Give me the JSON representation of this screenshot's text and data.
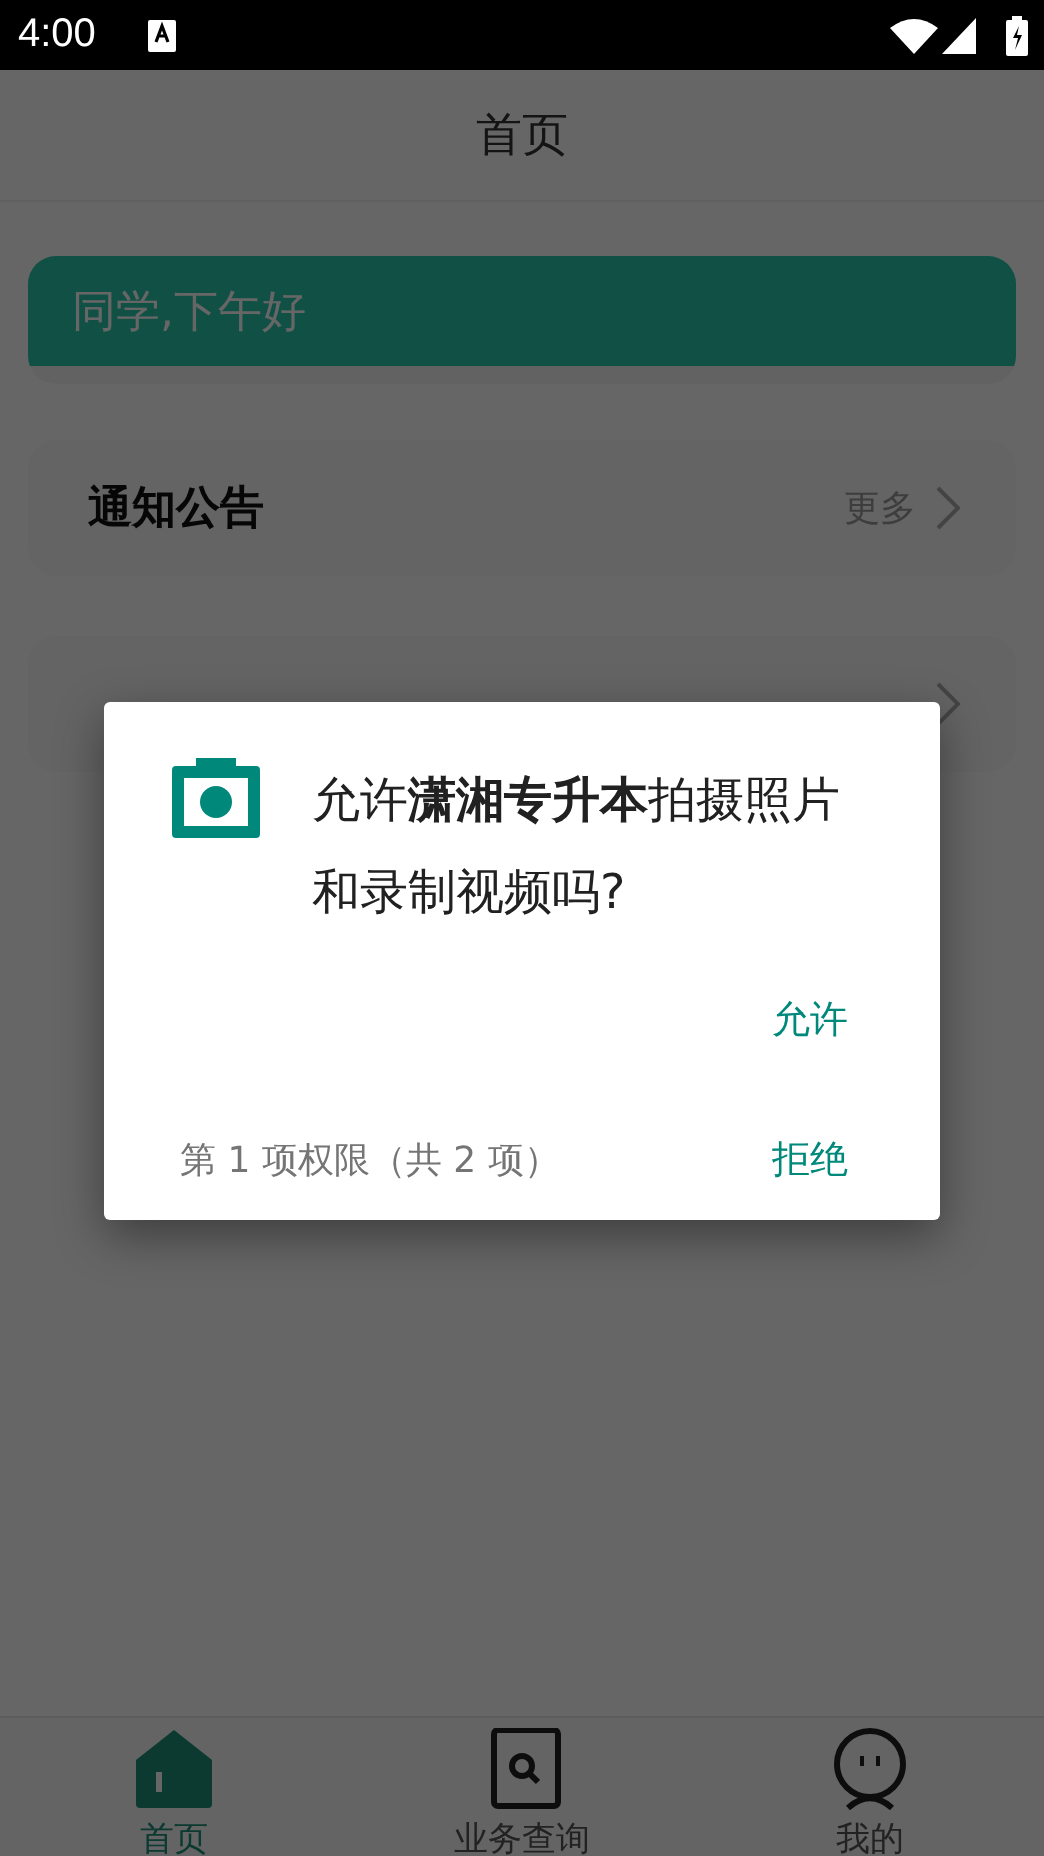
{
  "status_bar": {
    "time": "4:00"
  },
  "header": {
    "title": "首页"
  },
  "greeting": {
    "text": "同学,下午好"
  },
  "sections": [
    {
      "title": "通知公告",
      "more": "更多"
    }
  ],
  "permission_dialog": {
    "message": "允许**潇湘专升本**拍摄照片和录制视频吗?",
    "allow": "允许",
    "deny": "拒绝",
    "counter": "第 1 项权限（共 2 项）"
  },
  "bottom_nav": [
    {
      "kind": "home",
      "label": "首页",
      "selected": true
    },
    {
      "kind": "search",
      "label": "业务查询",
      "selected": false
    },
    {
      "kind": "profile",
      "label": "我的",
      "selected": false
    }
  ]
}
